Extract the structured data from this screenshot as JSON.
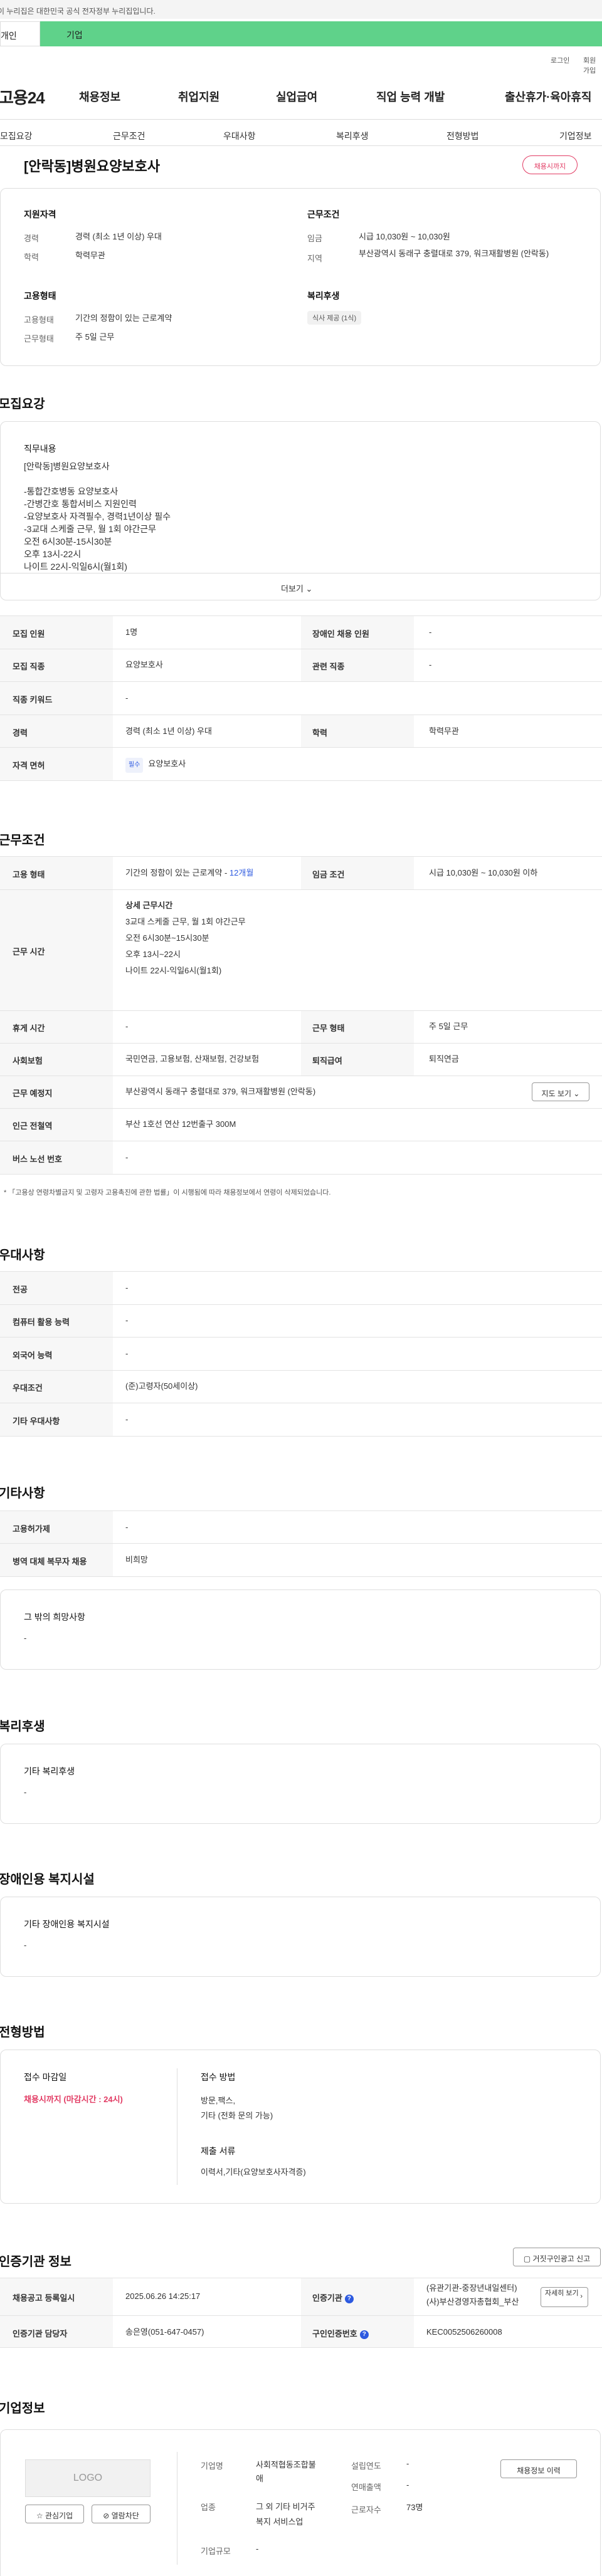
{
  "gov_notice": "이 누리집은 대한민국 공식 전자정부 누리집입니다.",
  "role_tabs": [
    "개인",
    "기업"
  ],
  "util": {
    "login": "로그인",
    "join": "회원가입"
  },
  "logo": "고용24",
  "gnb": [
    "채용정보",
    "취업지원",
    "실업급여",
    "직업 능력 개발",
    "출산휴가·육아휴직"
  ],
  "subnav": [
    "모집요강",
    "근무조건",
    "우대사항",
    "복리후생",
    "전형방법",
    "기업정보"
  ],
  "job": {
    "title": "[안락동]병원요양보호사",
    "status_badge": "채용시까지"
  },
  "summary": {
    "qual_title": "지원자격",
    "career_label": "경력",
    "career_value": "경력 (최소 1년 이상) 우대",
    "edu_label": "학력",
    "edu_value": "학력무관",
    "emp_title": "고용형태",
    "emp_label": "고용형태",
    "emp_value": "기간의 정함이 있는 근로계약",
    "work_label": "근무형태",
    "work_value": "주 5일 근무",
    "cond_title": "근무조건",
    "wage_label": "임금",
    "wage_value": "시급 10,030원 ~ 10,030원",
    "region_label": "지역",
    "region_value": "부산광역시 동래구 충렬대로 379, 워크재활병원 (안락동)",
    "welfare_title": "복리후생",
    "welfare_chip": "식사 제공 (1식)"
  },
  "recruit": {
    "section_title": "모집요강",
    "duty_title": "직무내용",
    "duty_lines": [
      "[안락동]병원요양보호사",
      "",
      "-통합간호병동 요양보호사",
      "-간병간호 통합서비스 지원인력",
      "-요양보호사 자격필수, 경력1년이상 필수",
      "-3교대 스케줄 근무, 월 1회 야간근무",
      "오전 6시30분-15시30분",
      "오후 13시-22시",
      "나이트 22시-익일6시(월1회)"
    ],
    "more": "더보기",
    "count_label": "모집 인원",
    "count_value": "1명",
    "disabled_label": "장애인 채용 인원",
    "disabled_value": "-",
    "job_label": "모집 직종",
    "job_value": "요양보호사",
    "related_label": "관련 직종",
    "related_value": "-",
    "keyword_label": "직종 키워드",
    "keyword_value": "-",
    "career_label": "경력",
    "career_value": "경력 (최소 1년 이상) 우대",
    "edu_label": "학력",
    "edu_value": "학력무관",
    "license_label": "자격 면허",
    "license_tag": "필수",
    "license_value": "요양보호사"
  },
  "conditions": {
    "section_title": "근무조건",
    "emp_label": "고용 형태",
    "emp_value": "기간의 정함이 있는 근로계약 - ",
    "emp_months": "12개월",
    "wage_label": "임금 조건",
    "wage_value": "시급 10,030원 ~ 10,030원 이하",
    "hours_label": "근무 시간",
    "hours_lines": [
      "상세 근무시간",
      "3교대 스케줄 근무, 월 1회 야간근무",
      "오전 6시30분~15시30분",
      "오후 13시~22시",
      "나이트 22시-익일6시(월1회)"
    ],
    "holiday_label": "휴게 시간",
    "holiday_value": "-",
    "worktype_label": "근무 형태",
    "worktype_value": "주 5일 근무",
    "insurance_label": "사회보험",
    "insurance_value": "국민연금, 고용보험, 산재보험, 건강보험",
    "severance_label": "퇴직급여",
    "severance_value": "퇴직연금",
    "place_label": "근무 예정지",
    "place_value": "부산광역시 동래구 충렬대로 379, 워크재활병원 (안락동)",
    "map_btn": "지도 보기",
    "subway_label": "인근 전철역",
    "subway_value": "부산 1호선 연산 12번출구 300M",
    "bus_label": "버스 노선 번호",
    "bus_value": "-",
    "note": "* 「고용상 연령차별금지 및 고령자 고용촉진에 관한 법률」이 시행됨에 따라 채용정보에서 연령이 삭제되었습니다."
  },
  "preference": {
    "section_title": "우대사항",
    "rows": [
      {
        "label": "전공",
        "value": "-"
      },
      {
        "label": "컴퓨터 활용 능력",
        "value": "-"
      },
      {
        "label": "외국어 능력",
        "value": "-"
      },
      {
        "label": "우대조건",
        "value": "(준)고령자(50세이상)"
      },
      {
        "label": "기타 우대사항",
        "value": "-"
      }
    ]
  },
  "etc": {
    "section_title": "기타사항",
    "employer_label": "고용허가제",
    "employer_value": "-",
    "military_label": "병역 대체 복무자 채용",
    "military_value": "비희망",
    "other_title": "그 밖의 희망사항",
    "other_value": "-"
  },
  "welfare": {
    "section_title": "복리후생",
    "card_title": "기타 복리후생",
    "card_value": "-"
  },
  "disability": {
    "section_title": "장애인용 복지시설",
    "card_title": "기타 장애인용 복지시설",
    "card_value": "-"
  },
  "process": {
    "section_title": "전형방법",
    "deadline_title": "접수 마감일",
    "deadline_value": "채용시까지 (마감시간 : 24시)",
    "method_title": "접수 방법",
    "method_lines": [
      "방문,팩스,",
      "기타 (전화 문의 가능)"
    ],
    "docs_title": "제출 서류",
    "docs_value": "이력서,기타(요양보호사자격증)"
  },
  "cert": {
    "section_title": "인증기관 정보",
    "report_btn": "거짓구인광고 신고",
    "reg_label": "채용공고 등록일시",
    "reg_value": "2025.06.26 14:25:17",
    "agency_label": "인증기관",
    "agency_lines": [
      "(유관기관-중장년내일센터)",
      "(사)부산경영자총협회_부산"
    ],
    "detail_btn": "자세히 보기",
    "manager_label": "인증기관 담당자",
    "manager_value": "송은영(051-647-0457)",
    "cert_no_label": "구인인증번호",
    "cert_no_value": "KEC0052506260008"
  },
  "company": {
    "section_title": "기업정보",
    "logo_text": "LOGO",
    "interest_btn": "관심기업",
    "block_btn": "열람차단",
    "name_label": "기업명",
    "name_lines": [
      "사회적협동조합불",
      "애"
    ],
    "industry_label": "업종",
    "industry_lines": [
      "그 외 기타 비거주",
      "복지 서비스업"
    ],
    "size_label": "기업규모",
    "size_value": "-",
    "founded_label": "설립연도",
    "founded_value": "-",
    "sales_label": "연매출액",
    "sales_value": "-",
    "employees_label": "근로자수",
    "employees_value": "73명",
    "jobs_btn": "채용정보 이력"
  }
}
